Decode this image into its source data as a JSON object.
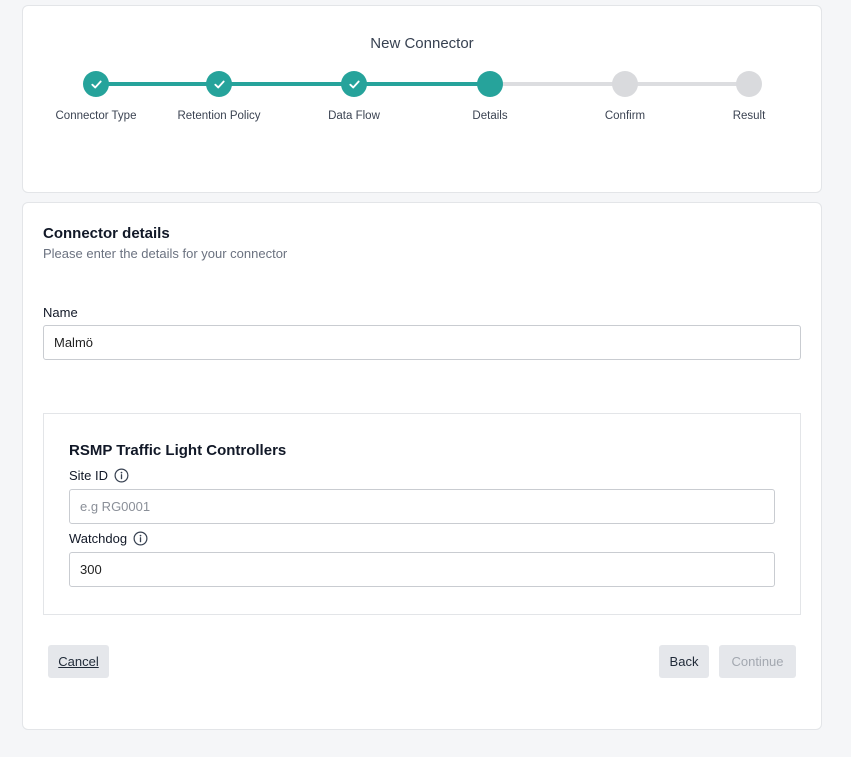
{
  "wizard": {
    "title": "New Connector",
    "steps": [
      {
        "label": "Connector Type",
        "state": "done"
      },
      {
        "label": "Retention Policy",
        "state": "done"
      },
      {
        "label": "Data Flow",
        "state": "done"
      },
      {
        "label": "Details",
        "state": "active"
      },
      {
        "label": "Confirm",
        "state": "todo"
      },
      {
        "label": "Result",
        "state": "todo"
      }
    ]
  },
  "details": {
    "title": "Connector details",
    "subtitle": "Please enter the details for your connector",
    "name_label": "Name",
    "name_value": "Malmö"
  },
  "rsmp": {
    "title": "RSMP Traffic Light Controllers",
    "site_id_label": "Site ID",
    "site_id_value": "",
    "site_id_placeholder": "e.g RG0001",
    "watchdog_label": "Watchdog",
    "watchdog_value": "300"
  },
  "actions": {
    "cancel": "Cancel",
    "back": "Back",
    "continue": "Continue"
  },
  "colors": {
    "accent": "#26a39b",
    "inactive": "#d9dadd"
  },
  "icons": {
    "step_done": "check-icon",
    "field_help": "info-icon"
  }
}
